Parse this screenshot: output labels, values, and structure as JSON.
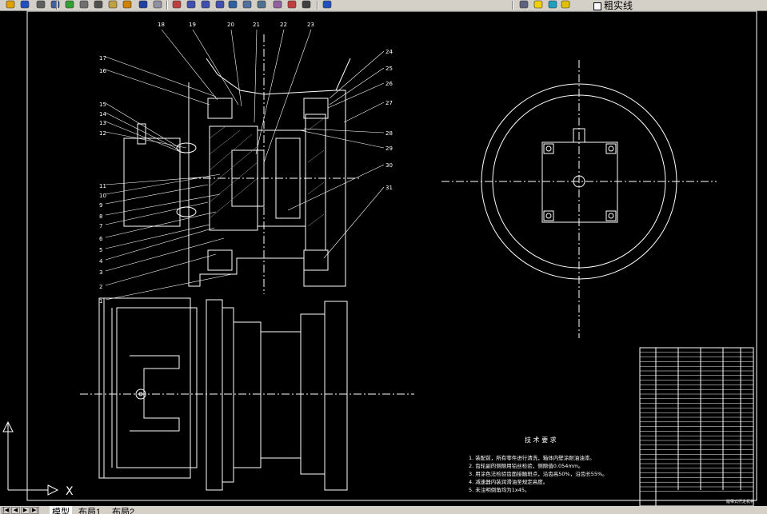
{
  "toolbar": {
    "buttons": [
      {
        "name": "open-icon"
      },
      {
        "name": "save-icon"
      },
      {
        "name": "print-icon"
      },
      {
        "name": "print-preview-icon"
      },
      {
        "name": "publish-icon"
      },
      {
        "name": "cut-icon"
      },
      {
        "name": "copy-icon"
      },
      {
        "name": "paste-icon"
      },
      {
        "name": "match-properties-icon"
      },
      {
        "name": "undo-icon"
      },
      {
        "name": "redo-icon"
      },
      {
        "name": "pan-icon"
      },
      {
        "name": "zoom-realtime-icon"
      },
      {
        "name": "zoom-window-icon"
      },
      {
        "name": "zoom-previous-icon"
      },
      {
        "name": "properties-icon"
      },
      {
        "name": "design-center-icon"
      },
      {
        "name": "tool-palette-icon"
      },
      {
        "name": "sheet-set-icon"
      },
      {
        "name": "markup-icon"
      },
      {
        "name": "calculator-icon"
      },
      {
        "name": "help-icon"
      },
      {
        "name": "layer-icon"
      },
      {
        "name": "layer-on-icon"
      },
      {
        "name": "layer-freeze-icon"
      },
      {
        "name": "layer-lock-icon"
      }
    ],
    "linetype_label": "粗实线"
  },
  "drawing": {
    "part_numbers_left": [
      "17",
      "16",
      "15",
      "14",
      "13",
      "12",
      "11",
      "10",
      "9",
      "8",
      "7",
      "6",
      "5",
      "4",
      "3",
      "2",
      "1"
    ],
    "part_numbers_top": [
      "18",
      "19",
      "20",
      "21",
      "22",
      "23"
    ],
    "part_numbers_right": [
      "24",
      "25",
      "26",
      "27",
      "28",
      "29",
      "30",
      "31"
    ],
    "tech_title": "技 术 要 求",
    "tech_lines": [
      "1. 装配前，所有零件进行清洗，箱体内壁涂耐油油漆。",
      "2. 齿轮副的侧隙用铅丝检验，侧隙值0.054mm。",
      "3. 用涂色法检验齿面接触斑点，沿齿高50%，沿齿长55%。",
      "4. 减速器内装润滑油至规定高度。",
      "5. 未注明倒角均为1x45。"
    ],
    "title_block_label": "履带式行走机构"
  },
  "tabs": {
    "nav": [
      "|◀",
      "◀",
      "▶",
      "▶|"
    ],
    "items": [
      "模型",
      "布局1",
      "布局2"
    ]
  }
}
